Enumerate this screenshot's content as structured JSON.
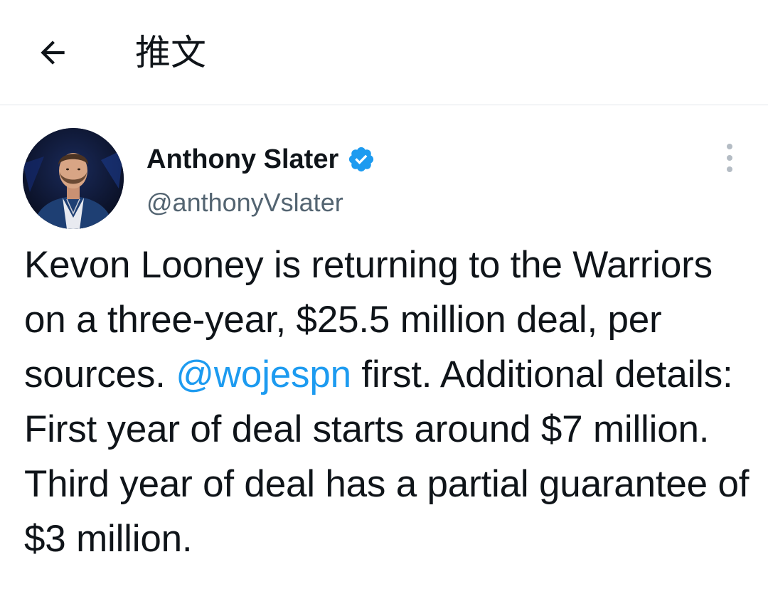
{
  "header": {
    "title": "推文",
    "back_icon": "arrow-left-icon"
  },
  "tweet": {
    "author": {
      "name": "Anthony Slater",
      "handle": "@anthonyVslater",
      "verified": true,
      "verified_color": "#1d9bf0"
    },
    "more_icon": "more-vertical-icon",
    "text_before": "Kevon Looney is returning to the Warriors on a three-year, $25.5 million deal, per sources. ",
    "mention": "@wojespn",
    "text_after": " first. Additional details: First year of deal starts around $7 million. Third year of deal has a partial guarantee of $3 million.",
    "mention_color": "#1d9bf0"
  }
}
